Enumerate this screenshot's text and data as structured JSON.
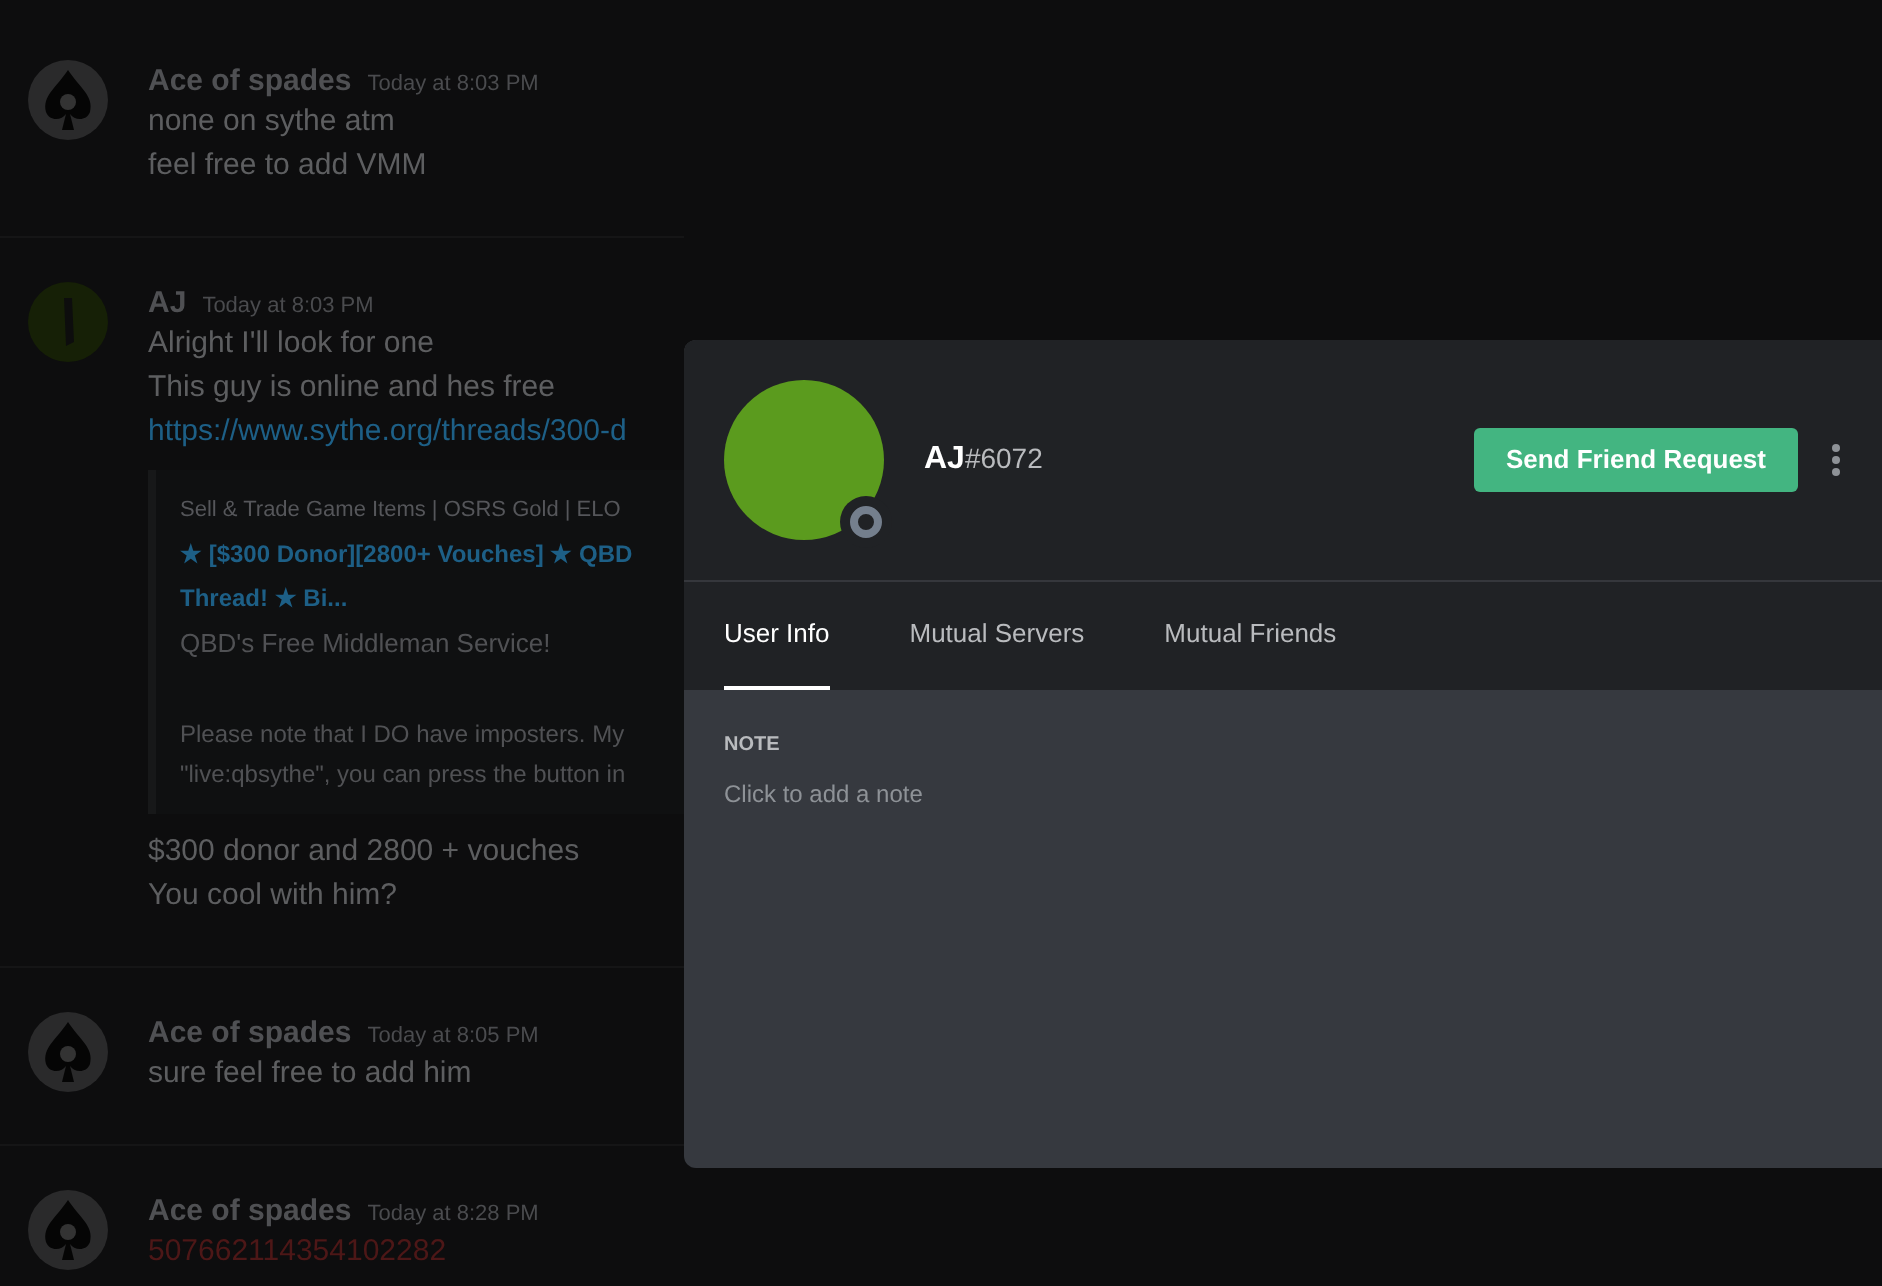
{
  "messages": [
    {
      "author": "Ace of spades",
      "timestamp": "Today at 8:03 PM",
      "avatar": {
        "kind": "spade"
      },
      "lines": [
        {
          "kind": "text",
          "text": "none on sythe atm"
        },
        {
          "kind": "text",
          "text": "feel free to add VMM"
        }
      ]
    },
    {
      "author": "AJ",
      "timestamp": "Today at 8:03 PM",
      "avatar": {
        "kind": "photo"
      },
      "lines": [
        {
          "kind": "text",
          "text": "Alright I'll look for one"
        },
        {
          "kind": "text",
          "text": "This guy is online and hes free"
        },
        {
          "kind": "link",
          "text": "https://www.sythe.org/threads/300-d"
        }
      ],
      "embed": {
        "provider": "Sell & Trade Game Items | OSRS Gold | ELO",
        "title_lines": [
          "★ [$300 Donor][2800+ Vouches] ★ QBD",
          "Thread! ★ Bi..."
        ],
        "description": "QBD's Free Middleman Service!",
        "body_lines": [
          "Please note that I DO have imposters. My",
          "\"live:qbsythe\", you can press the button in"
        ]
      },
      "after_lines": [
        {
          "kind": "text",
          "text": "$300 donor and 2800 + vouches"
        },
        {
          "kind": "text",
          "text": "You cool with him?"
        }
      ]
    },
    {
      "author": "Ace of spades",
      "timestamp": "Today at 8:05 PM",
      "avatar": {
        "kind": "spade"
      },
      "lines": [
        {
          "kind": "text",
          "text": "sure feel free to add him"
        }
      ]
    },
    {
      "author": "Ace of spades",
      "timestamp": "Today at 8:28 PM",
      "avatar": {
        "kind": "spade"
      },
      "lines": [
        {
          "kind": "alert",
          "text": "507662114354102282"
        }
      ]
    }
  ],
  "profile": {
    "username": "AJ",
    "discriminator": "#6072",
    "online": false,
    "button": "Send Friend Request",
    "tabs": [
      {
        "label": "User Info",
        "selected": true
      },
      {
        "label": "Mutual Servers",
        "selected": false
      },
      {
        "label": "Mutual Friends",
        "selected": false
      }
    ],
    "note": {
      "label": "NOTE",
      "placeholder": "Click to add a note"
    }
  }
}
